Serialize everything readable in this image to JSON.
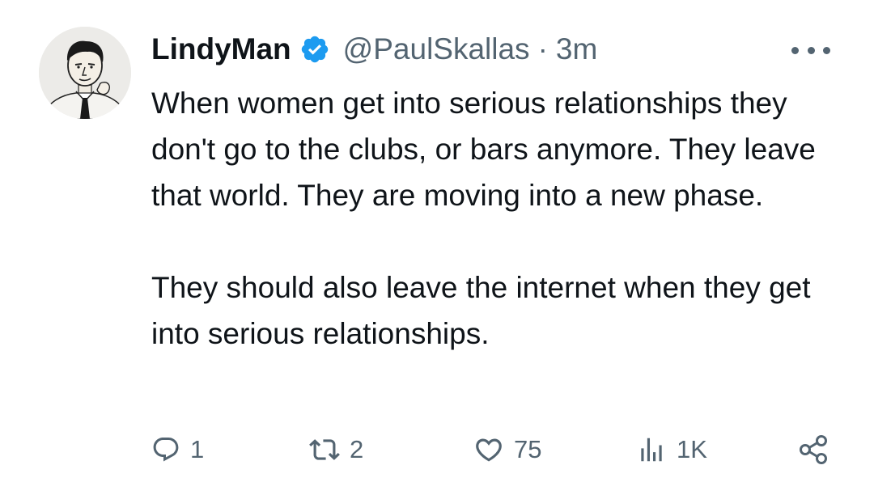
{
  "tweet": {
    "display_name": "LindyMan",
    "handle": "@PaulSkallas",
    "separator": "·",
    "time": "3m",
    "paragraph1": "When women get into serious relationships they don't go to the clubs, or bars anymore. They leave that world. They are moving into a new phase.",
    "paragraph2": "They should also leave the internet when they get into serious relationships."
  },
  "actions": {
    "replies": "1",
    "reposts": "2",
    "likes": "75",
    "views": "1K"
  },
  "icons": {
    "avatar": "cartoon-man-avatar",
    "verified": "verified-badge-icon",
    "more": "more-options-icon",
    "reply": "reply-icon",
    "repost": "repost-icon",
    "like": "heart-icon",
    "views": "views-icon",
    "share": "share-icon"
  },
  "colors": {
    "verified_blue": "#1d9bf0",
    "text": "#0f1419",
    "secondary": "#536471"
  }
}
